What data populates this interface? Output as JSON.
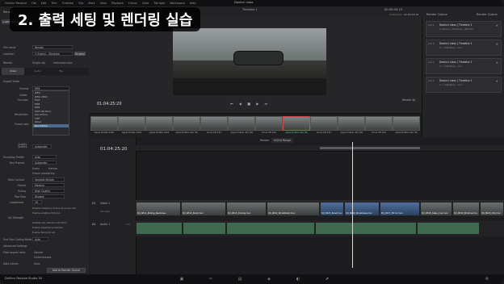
{
  "overlay_title": "2. 출력 세팅 및 렌더링 실습",
  "menubar": {
    "items": [
      "DaVinci Resolve",
      "File",
      "Edit",
      "Trim",
      "Timeline",
      "Clip",
      "Mark",
      "View",
      "Playback",
      "Fusion",
      "Color",
      "Fairlight",
      "Workspace",
      "Help"
    ],
    "project_title": "Davinci class"
  },
  "toolbar": {
    "render_label": "Render",
    "timeline_name": "Timeline 1",
    "timecode": "00:00:09:19",
    "duration_label": "DURATION",
    "duration": "00:00:42:18",
    "render_queue_title": "Render Queue",
    "render_queue_dropdown": "Render Queue"
  },
  "left_panel": {
    "presets": [
      "Custom Export",
      "H.264 Master",
      "YouTube",
      "Vimeo",
      "H.264",
      "Hyper Deck"
    ],
    "filename_label": "File name",
    "filename_value": "Render",
    "location_label": "Location",
    "location_value": "C:/Users/.../Desktop",
    "browse_label": "Browse",
    "render_label": "Render",
    "single_clip": "Single clip",
    "individual_clips": "Individual clips",
    "tabs": [
      "Video",
      "Audio",
      "File"
    ],
    "export_video_label": "Export Video",
    "format_label": "Format",
    "format_value": "MP4",
    "codec_label": "Codec",
    "encoder_label": "Encoder",
    "resolution_label": "Resolution",
    "frame_rate_label": "Frame rate",
    "quality_label": "Quality",
    "rate_control_label": "Rate Control",
    "encoding_profile_label": "Encoding Profile",
    "encoding_profile_value": "Auto",
    "keyframes_label": "Key Frames",
    "keyframes_value": "Automatic",
    "every_label": "Every",
    "frames_label": "frames",
    "frame_reordering": "Frame reordering",
    "rate_control_value": "Variable Bitrate",
    "preset_label": "Preset",
    "preset_value": "Medium",
    "tuning_label": "Tuning",
    "tuning_value": "High Quality",
    "two_pass_label": "Two Pass",
    "two_pass_value": "Disable",
    "lookahead_label": "Lookahead",
    "lookahead_value": "16",
    "aq_strength_label": "AQ Strength",
    "option_adaptive": "Disable adaptive I-frame at scene cuts",
    "option_adaptive_b": "Enable adaptive B-frame",
    "option_ref": "Disable use reference B-frame",
    "option_weighted": "Enable weighted prediction",
    "option_temporal": "Enable Temporal AQ",
    "end_of_ops_label": "End Gop Coding Mode",
    "end_of_ops_value": "Auto",
    "advanced_settings": "Advanced Settings",
    "pixel_aspect_label": "Pixel aspect ratio",
    "pixel_aspect_value": "Square",
    "pixel_aspect_alt": "Cinemascope",
    "data_levels_label": "Data Levels",
    "data_levels_value": "Auto",
    "add_to_queue": "Add to Render Queue",
    "format_options": [
      "JPEG",
      "JPEG 2000",
      "MXF",
      "MP4",
      "MP4",
      "MXF OP-Atom",
      "QuickTime",
      "TIFF",
      "Wave",
      "QuickTime"
    ],
    "format_selected": "QuickTime"
  },
  "viewer": {
    "timecode": "01:04:25:20",
    "render_all": "Render All"
  },
  "render_queue": {
    "jobs": [
      {
        "job": "Job 1",
        "name": "Davinci class | Timeline 1",
        "path": "C:/Users/.../Desktop/.../Render"
      },
      {
        "job": "Job 2",
        "name": "Davinci class | Timeline 1",
        "path": "C:/.../Desktop/...mov"
      },
      {
        "job": "Job 3",
        "name": "Davinci class | Timeline 1",
        "path": "C:/.../Desktop/...mov"
      },
      {
        "job": "Job 4",
        "name": "Davinci class | Timeline 1",
        "path": "C:/.../Desktop/...mov"
      }
    ]
  },
  "clips": [
    {
      "label": "Apple ProRes 4444"
    },
    {
      "label": "Apple ProRes 4444"
    },
    {
      "label": "Apple ProRes 4444"
    },
    {
      "label": "Apple ProRes 422 HQ"
    },
    {
      "label": "Drive HD 444"
    },
    {
      "label": "Apple ProRes 422 HQ"
    },
    {
      "label": "Drive HD 444"
    },
    {
      "label": "Apple ProRes 422 HQ"
    },
    {
      "label": "Drive HD 444"
    },
    {
      "label": "Apple ProRes 422 HQ"
    },
    {
      "label": "Drive HD 444"
    },
    {
      "label": "Apple ProRes 422 HQ"
    }
  ],
  "timeline": {
    "timecode": "01:04:25:20",
    "render_label": "Render",
    "render_range": "In/Out Range",
    "v1_label": "V1",
    "v1_name": "Video 1",
    "a1_label": "A1",
    "a1_name": "Audio 1",
    "a1_level": "2.0",
    "clip_count": "24 Clips",
    "video_clips": [
      "DJI_0011_Rolling_Rearview...",
      "DJI_0012_Road.mov",
      "DJI_0013_Driving.mov",
      "DJI_0014_Windshield.mov",
      "DJI_0015_Road.mov",
      "DJI_0016_Streetview.mov",
      "DJI_0017_Mirror.mov",
      "DJI_0018_Glass_Cup.mov",
      "DJI_0019_Window.mov",
      "DJI_0020_City.mov"
    ]
  },
  "bottom": {
    "brand": "DaVinci Resolve Studio 18"
  }
}
